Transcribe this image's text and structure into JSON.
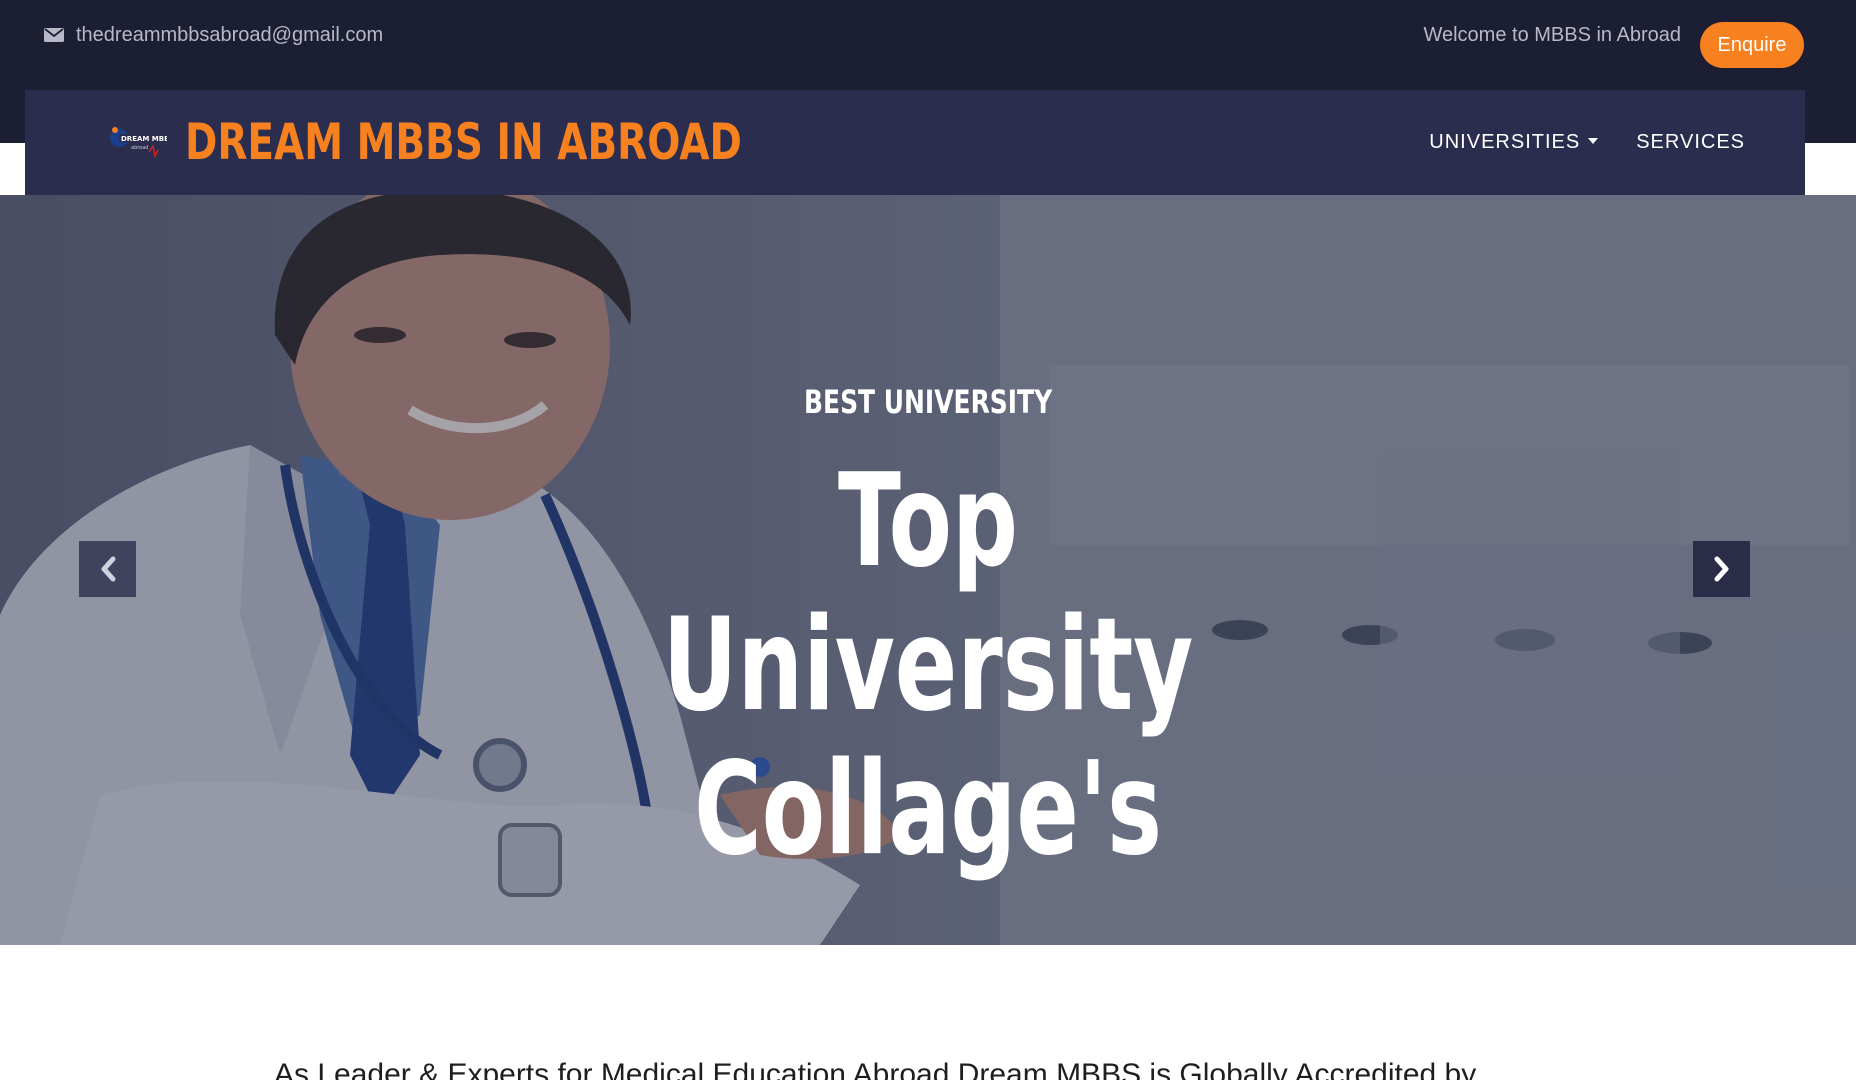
{
  "topbar": {
    "email": "thedreammbbsabroad@gmail.com",
    "email_icon": "envelope-icon",
    "welcome": "Welcome to MBBS in Abroad",
    "enquire_label": "Enquire"
  },
  "navbar": {
    "brand": "DREAM MBBS IN ABROAD",
    "logo_icon": "dream-mbbs-logo",
    "links": [
      {
        "label": "UNIVERSITIES",
        "has_dropdown": true
      },
      {
        "label": "SERVICES",
        "has_dropdown": false
      }
    ]
  },
  "hero": {
    "eyebrow": "BEST UNIVERSITY",
    "headline_line1": "Top University",
    "headline_line2": "Collage's",
    "prev_icon": "chevron-left-icon",
    "next_icon": "chevron-right-icon"
  },
  "intro": {
    "text": "As Leader & Experts for Medical Education Abroad Dream MBBS is Globally Accredited by"
  },
  "colors": {
    "accent": "#f7811f",
    "topbar_bg": "#1c1e33",
    "navbar_bg": "#2b2d4e"
  }
}
